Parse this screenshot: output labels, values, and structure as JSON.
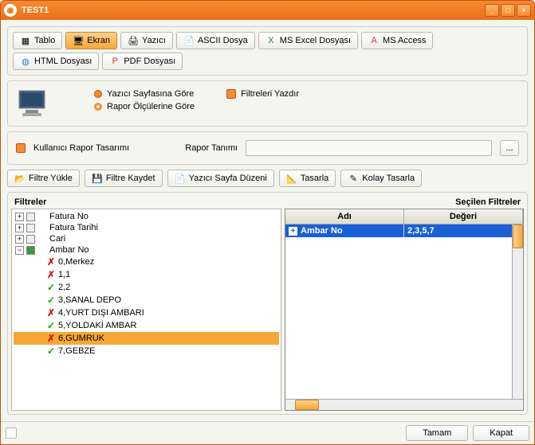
{
  "window": {
    "title": "TEST1"
  },
  "toolbar": {
    "tablo": "Tablo",
    "ekran": "Ekran",
    "yazici": "Yazıcı",
    "ascii": "ASCII Dosya",
    "excel": "MS Excel Dosyası",
    "access": "MS Access",
    "html": "HTML Dosyası",
    "pdf": "PDF Dosyası"
  },
  "options": {
    "yazici_sayfa": "Yazıcı Sayfasına Göre",
    "rapor_olcu": "Rapor Ölçülerine Göre",
    "filtre_yazdir": "Filtreleri Yazdır"
  },
  "report": {
    "user_design": "Kullanıcı Rapor Tasarımı",
    "definition_label": "Rapor Tanımı",
    "definition_value": ""
  },
  "actions": {
    "load": "Filtre Yükle",
    "save": "Filtre Kaydet",
    "page_layout": "Yazıcı Sayfa Düzeni",
    "design": "Tasarla",
    "easy_design": "Kolay Tasarla"
  },
  "filters": {
    "left_title": "Filtreler",
    "right_title": "Seçilen Filtreler",
    "nodes": [
      {
        "label": "Fatura No",
        "kind": "parent"
      },
      {
        "label": "Fatura Tarihi",
        "kind": "parent"
      },
      {
        "label": "Cari",
        "kind": "parent"
      },
      {
        "label": "Ambar No",
        "kind": "parent-open"
      }
    ],
    "ambar": [
      {
        "label": "0,Merkez",
        "status": "red"
      },
      {
        "label": "1,1",
        "status": "red"
      },
      {
        "label": "2,2",
        "status": "green"
      },
      {
        "label": "3,SANAL DEPO",
        "status": "green"
      },
      {
        "label": "4,YURT DIŞI AMBARI",
        "status": "red"
      },
      {
        "label": "5,YOLDAKİ AMBAR",
        "status": "green"
      },
      {
        "label": "6,GUMRUK",
        "status": "red",
        "selected": true
      },
      {
        "label": "7,GEBZE",
        "status": "green"
      }
    ],
    "grid_headers": {
      "name": "Adı",
      "value": "Değeri"
    },
    "grid_row": {
      "name": "Ambar No",
      "value": "2,3,5,7"
    }
  },
  "footer": {
    "ok": "Tamam",
    "close": "Kapat"
  }
}
